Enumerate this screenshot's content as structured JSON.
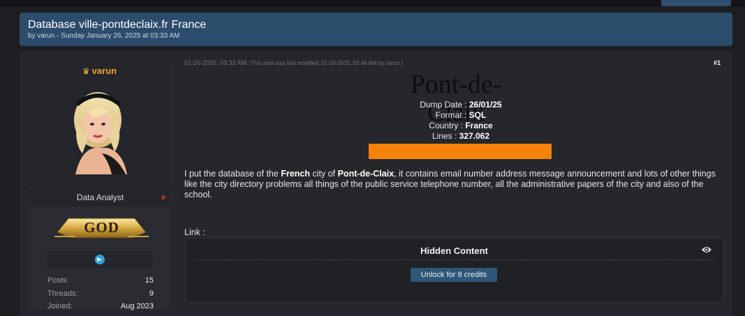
{
  "thread": {
    "title": "Database ville-pontdeclaix.fr France",
    "subtitle": "by varun - Sunday January 26, 2025 at 03:33 AM"
  },
  "user": {
    "username": "varun",
    "title": "Data Analyst",
    "rank": "GOD",
    "stats": [
      {
        "label": "Posts:",
        "value": "15"
      },
      {
        "label": "Threads:",
        "value": "9"
      },
      {
        "label": "Joined:",
        "value": "Aug 2023"
      }
    ],
    "colors": {
      "username": "#f0a32a",
      "status": "#b32a2a"
    }
  },
  "post": {
    "date": "01-26-2025, 03:33 AM",
    "modified": "(This post was last modified: 01-26-2025, 03:40 AM by varun.)",
    "number": "#1",
    "logo_text": "Pont-de-Claix",
    "dump": {
      "date_label": "Dump Date : ",
      "date_value": "26/01/25",
      "format_label": "Format : ",
      "format_value": "SQL",
      "country_label": "Country : ",
      "country_value": "France",
      "lines_label": "Lines : ",
      "lines_value": "327.062"
    },
    "body": {
      "p1": "I put the database of the ",
      "b1": "French",
      "p2": " city of ",
      "b2": "Pont-de-Claix",
      "p3": ", it contains email number address message announcement and lots of other things like the city directory problems all things of the public service telephone number, all the administrative papers of the city and also of the school."
    },
    "link_label": "Link :",
    "accent_color": "#f5820a"
  },
  "hidden_content": {
    "title": "Hidden Content",
    "button": "Unlock for 8 credits"
  }
}
